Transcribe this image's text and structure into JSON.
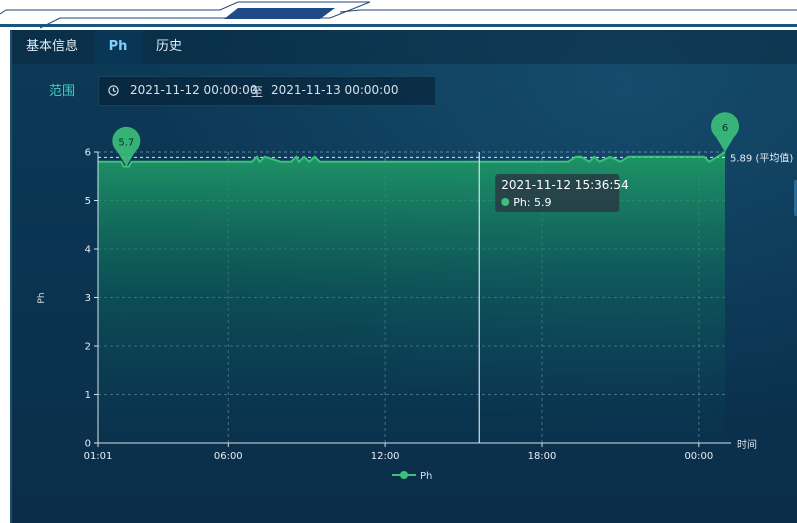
{
  "tabs": [
    {
      "label": "基本信息"
    },
    {
      "label": "Ph"
    },
    {
      "label": "历史"
    }
  ],
  "filter": {
    "range_label": "范围",
    "start": "2021-11-12 00:00:00",
    "separator": "至",
    "end": "2021-11-13 00:00:00",
    "clock_icon": "clock-icon"
  },
  "colors": {
    "line": "#3cc07a",
    "accent": "#3fd0c2",
    "crosshair": "#d6e2ea"
  },
  "chart_data": {
    "type": "area",
    "ylabel": "Ph",
    "xlabel": "时间",
    "ylim": [
      0,
      6
    ],
    "yticks": [
      "0",
      "1",
      "2",
      "3",
      "4",
      "5",
      "6"
    ],
    "xticks": [
      "01:01",
      "06:00",
      "12:00",
      "18:00",
      "00:00"
    ],
    "xtick_hours": [
      1.017,
      6,
      12,
      18,
      24
    ],
    "xrange_hours": [
      1.017,
      25.0
    ],
    "grid": true,
    "legend": {
      "position": "bottom",
      "items": [
        "Ph"
      ]
    },
    "series": [
      {
        "name": "Ph",
        "x_hours": [
          1.017,
          1.5,
          1.9,
          2.0,
          2.2,
          2.3,
          6.0,
          6.9,
          7.1,
          7.2,
          7.4,
          8.0,
          8.4,
          8.6,
          8.7,
          8.9,
          9.1,
          9.3,
          9.5,
          15.5,
          19.0,
          19.3,
          19.5,
          19.8,
          20.0,
          20.2,
          20.6,
          21.0,
          21.3,
          24.2,
          24.4,
          24.7,
          25.0
        ],
        "values": [
          5.8,
          5.8,
          5.8,
          5.7,
          5.7,
          5.8,
          5.8,
          5.8,
          5.9,
          5.8,
          5.9,
          5.8,
          5.8,
          5.9,
          5.8,
          5.9,
          5.8,
          5.9,
          5.8,
          5.8,
          5.8,
          5.9,
          5.9,
          5.8,
          5.9,
          5.8,
          5.9,
          5.8,
          5.9,
          5.9,
          5.8,
          5.9,
          6.0
        ]
      }
    ],
    "markers": [
      {
        "label": "5.7",
        "x_hours": 2.1,
        "y": 5.7
      },
      {
        "label": "6",
        "x_hours": 25.0,
        "y": 6.0
      }
    ],
    "average": {
      "value": 5.89,
      "label": "5.89 (平均值)"
    },
    "tooltip": {
      "time": "2021-11-12 15:36:54",
      "x_hours": 15.6,
      "series": "Ph",
      "value_text": "Ph: 5.9"
    }
  }
}
